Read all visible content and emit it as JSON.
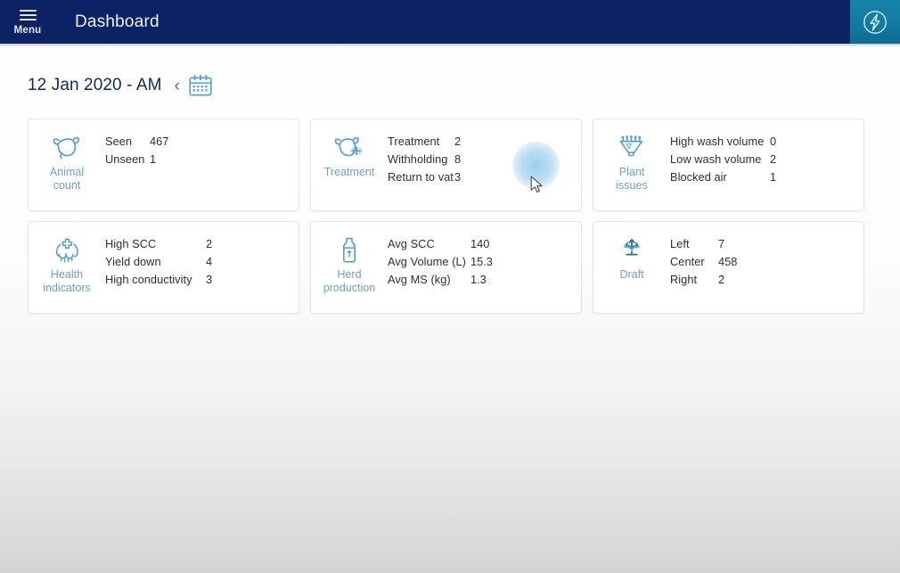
{
  "topbar": {
    "menu_label": "Menu",
    "menu_icon": "hamburger-icon",
    "title": "Dashboard",
    "brand_icon": "lightning-bolt-circle-icon",
    "background_color": "#0b2265",
    "brand_color": "#1379a2"
  },
  "date_bar": {
    "date_text": "12 Jan 2020 - AM",
    "prev_label": "‹",
    "prev_icon": "chevron-left-icon",
    "calendar_icon": "calendar-icon"
  },
  "cards": [
    {
      "icon": "cow-head-icon",
      "title": "Animal\ncount",
      "title_line1": "Animal",
      "title_line2": "count",
      "stats": [
        {
          "label": "Seen",
          "value": "467"
        },
        {
          "label": "Unseen",
          "value": "1"
        }
      ]
    },
    {
      "icon": "cow-treatment-icon",
      "title": "Treatment",
      "title_line1": "Treatment",
      "title_line2": "",
      "stats": [
        {
          "label": "Treatment",
          "value": "2"
        },
        {
          "label": "Withholding",
          "value": "8"
        },
        {
          "label": "Return to vat",
          "value": "3"
        }
      ]
    },
    {
      "icon": "milking-cluster-icon",
      "title": "Plant\nissues",
      "title_line1": "Plant",
      "title_line2": "issues",
      "stats": [
        {
          "label": "High wash volume",
          "value": "0"
        },
        {
          "label": "Low wash volume",
          "value": "2"
        },
        {
          "label": "Blocked air",
          "value": "1"
        }
      ]
    },
    {
      "icon": "udder-health-cross-icon",
      "title": "Health\nindicators",
      "title_line1": "Health",
      "title_line2": "indicators",
      "stats": [
        {
          "label": "High SCC",
          "value": "2"
        },
        {
          "label": "Yield down",
          "value": "4"
        },
        {
          "label": "High conductivity",
          "value": "3"
        }
      ]
    },
    {
      "icon": "milk-bottle-icon",
      "title": "Herd\nproduction",
      "title_line1": "Herd",
      "title_line2": "production",
      "stats": [
        {
          "label": "Avg SCC",
          "value": "140"
        },
        {
          "label": "Avg Volume (L)",
          "value": "15.3"
        },
        {
          "label": "Avg MS (kg)",
          "value": "1.3"
        }
      ]
    },
    {
      "icon": "draft-fork-arrows-icon",
      "title": "Draft",
      "title_line1": "Draft",
      "title_line2": "",
      "stats": [
        {
          "label": "Left",
          "value": "7"
        },
        {
          "label": "Center",
          "value": "458"
        },
        {
          "label": "Right",
          "value": "2"
        }
      ]
    }
  ],
  "pointer": {
    "ripple_color": "#82c1e9",
    "cursor_icon": "arrow-cursor"
  },
  "theme": {
    "icon_color": "#5aa0c8",
    "icon_label_color": "#6f9fc4",
    "card_border": "#e3e4e8",
    "text_color": "#2c2f36"
  }
}
